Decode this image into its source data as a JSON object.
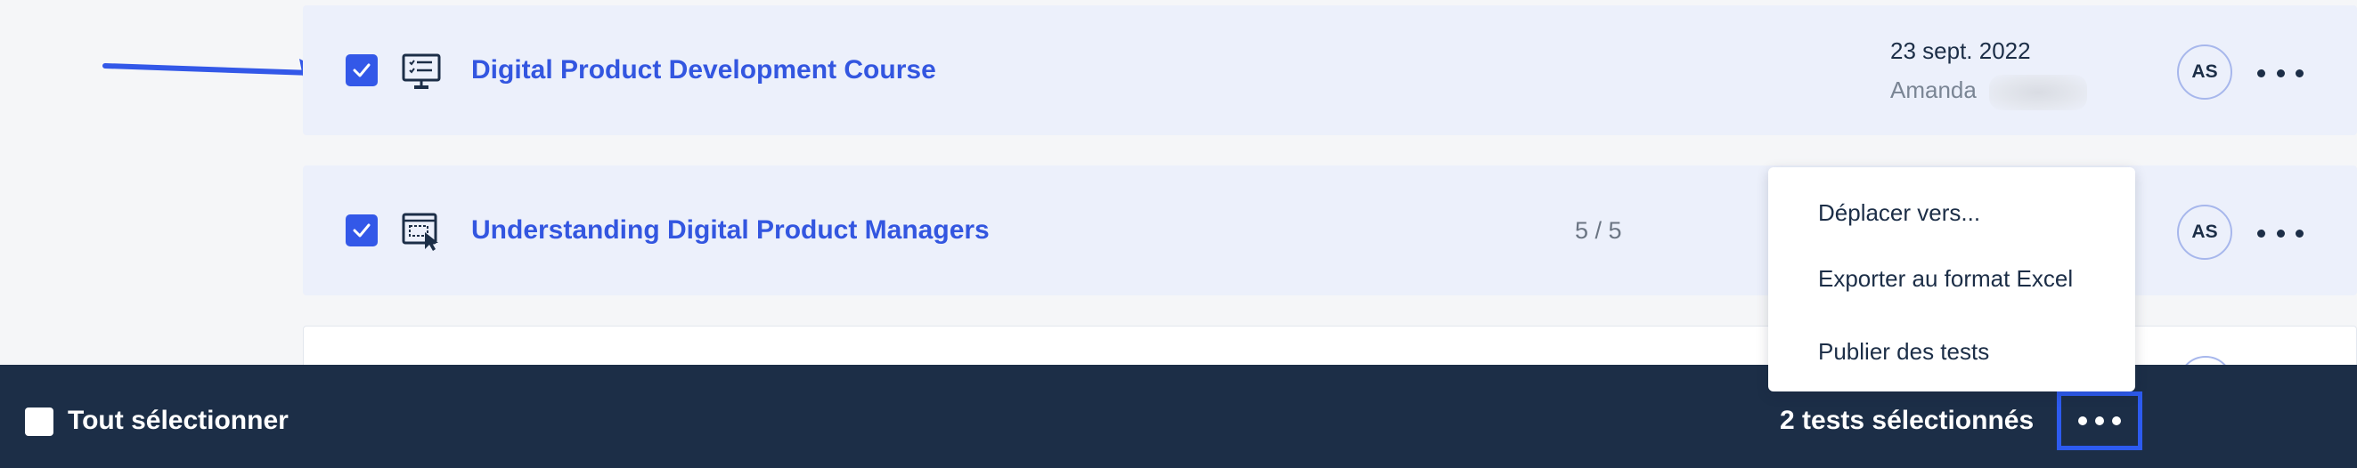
{
  "rows": [
    {
      "title": "Digital Product Development Course",
      "icon": "presentation-checklist-icon",
      "checked": true,
      "date": "23 sept. 2022",
      "author": "Amanda",
      "avatar": "AS"
    },
    {
      "title": "Understanding Digital Product Managers",
      "icon": "selection-cursor-icon",
      "checked": true,
      "score": "5 / 5",
      "avatar": "AS"
    }
  ],
  "context_menu": {
    "items": [
      {
        "label": "Déplacer vers..."
      },
      {
        "label": "Exporter au format Excel"
      },
      {
        "label": "Publier des tests"
      }
    ]
  },
  "bottom_bar": {
    "select_all_label": "Tout sélectionner",
    "select_all_checked": false,
    "selected_count_label": "2 tests sélectionnés"
  },
  "colors": {
    "accent": "#3358e8",
    "title_link": "#3356e0",
    "row_selected_bg": "#ecf0fb",
    "bottom_bar_bg": "#1c2e47",
    "highlight_outline": "#2d5bf0"
  }
}
